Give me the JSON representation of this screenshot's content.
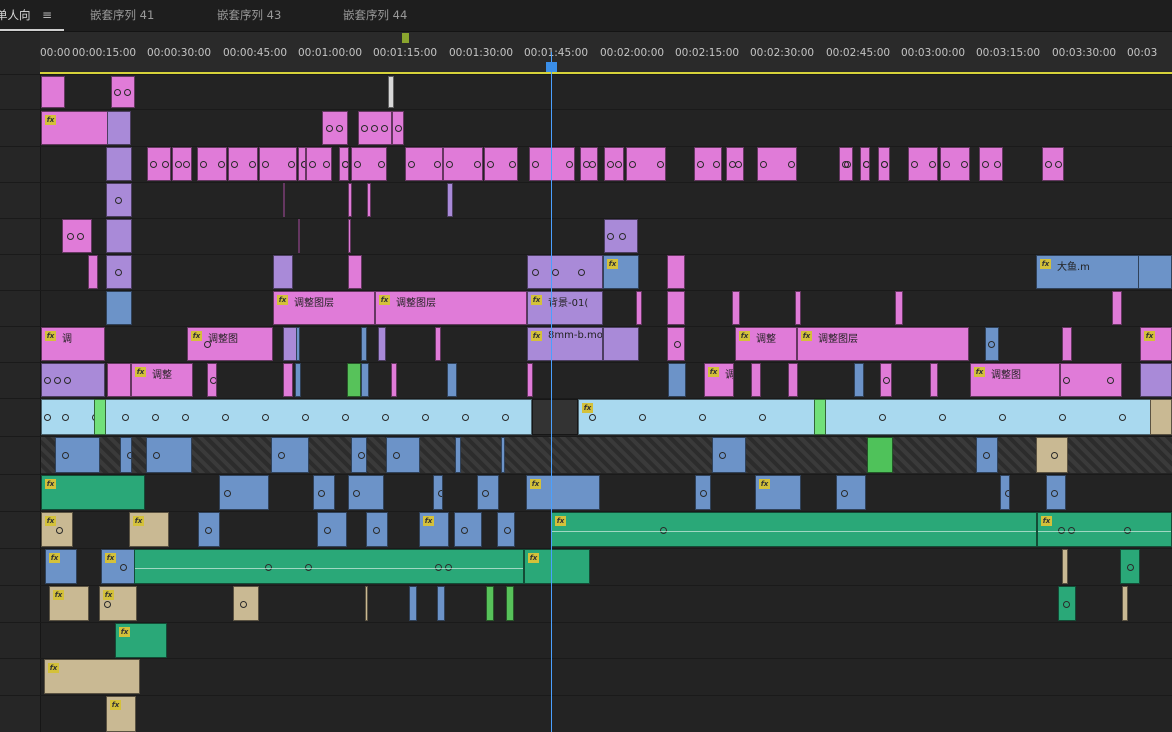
{
  "tabs": [
    {
      "label": "单人向",
      "active": true
    },
    {
      "label": "嵌套序列 41",
      "active": false
    },
    {
      "label": "嵌套序列 43",
      "active": false
    },
    {
      "label": "嵌套序列 44",
      "active": false
    }
  ],
  "menu_icon": "≡",
  "ruler_ticks": [
    "00:00",
    "00:00:15:00",
    "00:00:30:00",
    "00:00:45:00",
    "00:01:00:00",
    "00:01:15:00",
    "00:01:30:00",
    "00:01:45:00",
    "00:02:00:00",
    "00:02:15:00",
    "00:02:30:00",
    "00:02:45:00",
    "00:03:00:00",
    "00:03:15:00",
    "00:03:30:00",
    "00:03"
  ],
  "clip_labels": {
    "adjust_layer": "调整图层",
    "adjust_short": "调整",
    "adjust_cut": "调",
    "adjust_img": "调整图",
    "background": "背景-01(",
    "mov": "8mm-b.mov",
    "fish": "大鱼.m"
  },
  "fx_badge": "fx",
  "colors": {
    "pink": "#e07bd8",
    "purple": "#a98ad8",
    "blue": "#6c93c8",
    "cyan": "#a9d9ef",
    "green": "#2aa878",
    "tan": "#c9b993",
    "accent_playhead": "#4aa0ff"
  }
}
